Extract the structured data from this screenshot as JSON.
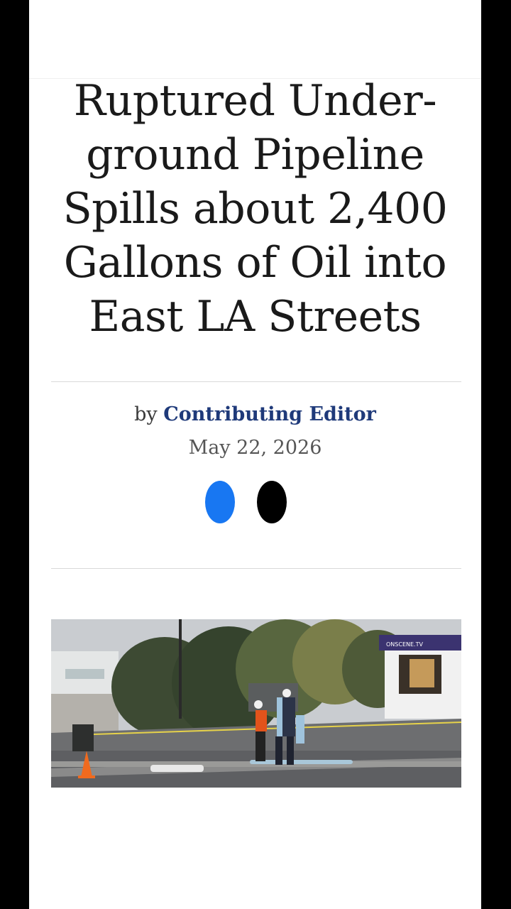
{
  "article": {
    "headline": "Ruptured Under-ground Pipeline Spills about 2,400 Gallons of Oil into East LA Streets",
    "byline_prefix": "by",
    "author": "Contributing Editor",
    "date": "May 22, 2026"
  },
  "share": {
    "facebook_glyph": "",
    "x_glyph": ""
  },
  "photo": {
    "watermark": "ONSCENE.TV"
  },
  "colors": {
    "author": "#1f3a7a",
    "facebook": "#1877f2"
  }
}
